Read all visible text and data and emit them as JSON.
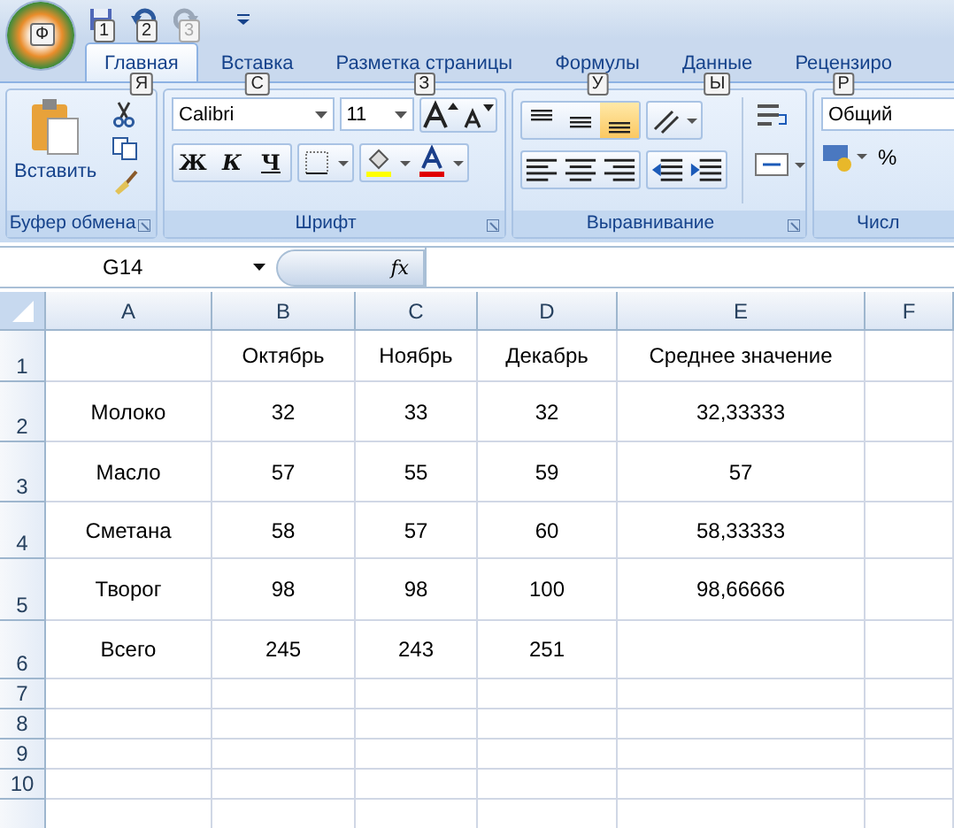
{
  "office_button": {
    "keytip": "Ф"
  },
  "quick_access": [
    {
      "kind": "save",
      "keytip": "1",
      "disabled": false
    },
    {
      "kind": "undo",
      "keytip": "2",
      "disabled": false
    },
    {
      "kind": "redo",
      "keytip": "3",
      "disabled": true
    }
  ],
  "tabs": [
    {
      "label": "Главная",
      "keytip": "Я",
      "selected": true
    },
    {
      "label": "Вставка",
      "keytip": "С",
      "selected": false
    },
    {
      "label": "Разметка страницы",
      "keytip": "З",
      "selected": false
    },
    {
      "label": "Формулы",
      "keytip": "У",
      "selected": false
    },
    {
      "label": "Данные",
      "keytip": "Ы",
      "selected": false
    },
    {
      "label": "Рецензиро",
      "keytip": "Р",
      "selected": false
    }
  ],
  "ribbon": {
    "clipboard": {
      "label": "Буфер обмена",
      "paste": "Вставить"
    },
    "font": {
      "label": "Шрифт",
      "font_name": "Calibri",
      "font_size": "11",
      "bold": "Ж",
      "italic": "К",
      "underline": "Ч"
    },
    "alignment": {
      "label": "Выравнивание",
      "vertical": [
        {
          "kind": "top",
          "selected": false
        },
        {
          "kind": "middle",
          "selected": false
        },
        {
          "kind": "bottom",
          "selected": true
        }
      ]
    },
    "number": {
      "label": "Числ",
      "format": "Общий",
      "percent": "%"
    }
  },
  "formula_bar": {
    "name_box": "G14",
    "fx": "fx"
  },
  "sheet": {
    "columns": [
      "A",
      "B",
      "C",
      "D",
      "E",
      "F"
    ],
    "rows": [
      {
        "number": "1",
        "cells": [
          "",
          "Октябрь",
          "Ноябрь",
          "Декабрь",
          "Среднее значение",
          ""
        ]
      },
      {
        "number": "2",
        "cells": [
          "Молоко",
          "32",
          "33",
          "32",
          "32,33333",
          ""
        ]
      },
      {
        "number": "3",
        "cells": [
          "Масло",
          "57",
          "55",
          "59",
          "57",
          ""
        ]
      },
      {
        "number": "4",
        "cells": [
          "Сметана",
          "58",
          "57",
          "60",
          "58,33333",
          ""
        ]
      },
      {
        "number": "5",
        "cells": [
          "Творог",
          "98",
          "98",
          "100",
          "98,66666",
          ""
        ]
      },
      {
        "number": "6",
        "cells": [
          "Всего",
          "245",
          "243",
          "251",
          "",
          ""
        ]
      },
      {
        "number": "7",
        "cells": [
          "",
          "",
          "",
          "",
          "",
          ""
        ]
      },
      {
        "number": "8",
        "cells": [
          "",
          "",
          "",
          "",
          "",
          ""
        ]
      },
      {
        "number": "9",
        "cells": [
          "",
          "",
          "",
          "",
          "",
          ""
        ]
      },
      {
        "number": "10",
        "cells": [
          "",
          "",
          "",
          "",
          "",
          ""
        ]
      }
    ]
  }
}
